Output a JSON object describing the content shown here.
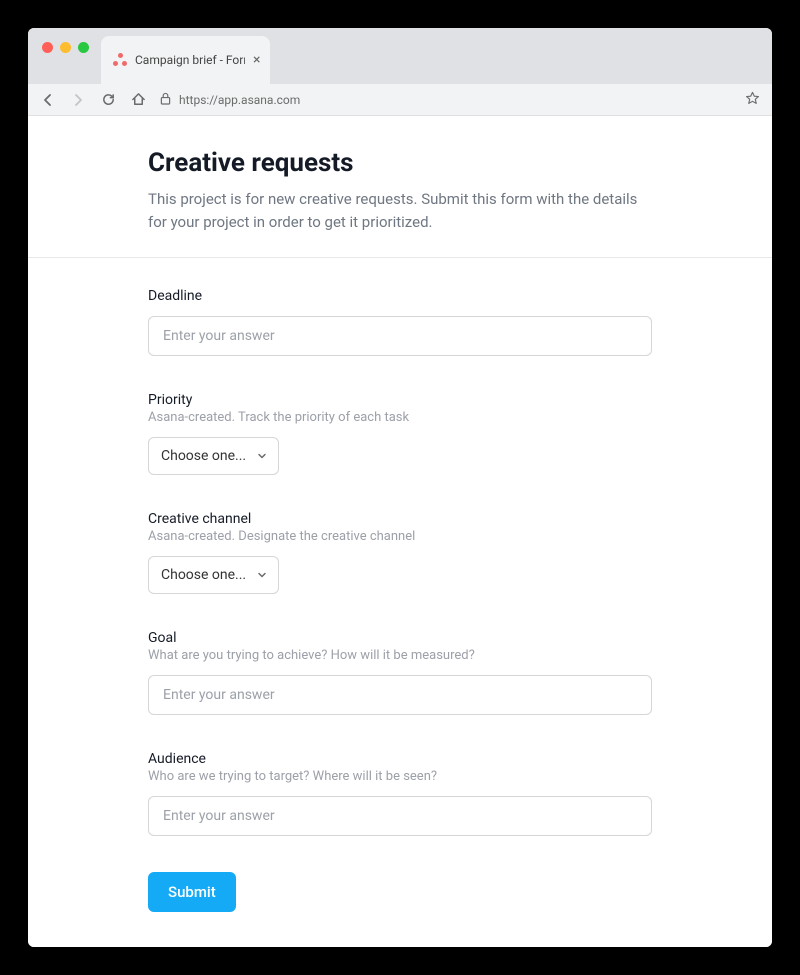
{
  "browser": {
    "tab_title": "Campaign brief - Form by As",
    "url": "https://app.asana.com"
  },
  "header": {
    "title": "Creative requests",
    "description": "This project is for new creative requests. Submit this form with the details for your project in order to get it prioritized."
  },
  "fields": {
    "deadline": {
      "label": "Deadline",
      "placeholder": "Enter your answer"
    },
    "priority": {
      "label": "Priority",
      "hint": "Asana-created. Track the priority of each task",
      "selected": "Choose one..."
    },
    "channel": {
      "label": "Creative channel",
      "hint": "Asana-created. Designate the creative channel",
      "selected": "Choose one..."
    },
    "goal": {
      "label": "Goal",
      "hint": "What are you trying to achieve? How will it be measured?",
      "placeholder": "Enter your answer"
    },
    "audience": {
      "label": "Audience",
      "hint": "Who are we trying to target? Where will it be seen?",
      "placeholder": "Enter your answer"
    }
  },
  "submit_label": "Submit"
}
